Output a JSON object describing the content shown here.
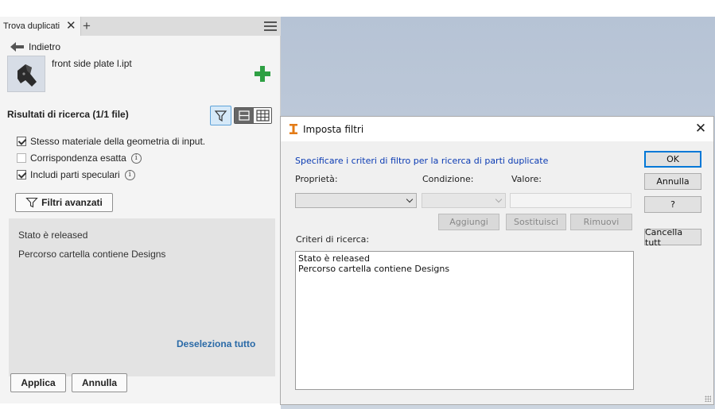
{
  "panel": {
    "tab_label": "Trova duplicati",
    "tab_close": "✕",
    "tab_add": "+",
    "back_label": "Indietro",
    "part_name": "front side plate l.ipt",
    "results_title": "Risultati di ricerca (1/1 file)",
    "options": [
      {
        "label": "Stesso materiale della geometria di input.",
        "checked": true
      },
      {
        "label": "Corrispondenza esatta",
        "checked": false
      },
      {
        "label": "Includi parti speculari",
        "checked": true
      }
    ],
    "info_glyph": "i",
    "advanced_filters_label": "Filtri avanzati",
    "criteria": [
      "Stato è released",
      "Percorso cartella contiene Designs"
    ],
    "deselect_all": "Deseleziona tutto",
    "apply_label": "Applica",
    "cancel_label": "Annulla",
    "accent_color": "#2ea043",
    "link_color": "#2a6aa7"
  },
  "dialog": {
    "title": "Imposta filtri",
    "close": "✕",
    "instruction": "Specificare i criteri di filtro per la ricerca di parti duplicate",
    "property_label": "Proprietà:",
    "condition_label": "Condizione:",
    "value_label": "Valore:",
    "add_label": "Aggiungi",
    "replace_label": "Sostituisci",
    "remove_label": "Rimuovi",
    "criteria_label": "Criteri di ricerca:",
    "criteria": [
      "Stato è released",
      "Percorso cartella contiene Designs"
    ],
    "ok_label": "OK",
    "cancel_label": "Annulla",
    "help_label": "?",
    "clear_all_label": "Cancella tutt",
    "instruction_color": "#0b3bb3"
  }
}
